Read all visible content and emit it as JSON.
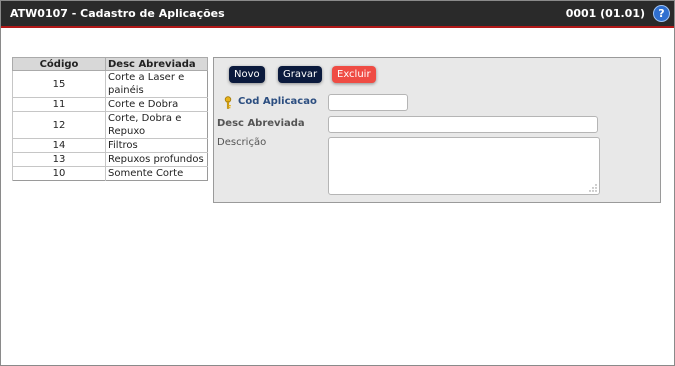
{
  "window": {
    "title": "ATW0107 - Cadastro de Aplicações",
    "code": "0001 (01.01)",
    "help_label": "?"
  },
  "list": {
    "headers": {
      "code": "Código",
      "desc": "Desc Abreviada"
    },
    "rows": [
      {
        "code": "15",
        "desc": "Corte a Laser e painéis"
      },
      {
        "code": "11",
        "desc": "Corte e Dobra"
      },
      {
        "code": "12",
        "desc": "Corte, Dobra e Repuxo"
      },
      {
        "code": "14",
        "desc": "Filtros"
      },
      {
        "code": "13",
        "desc": "Repuxos profundos"
      },
      {
        "code": "10",
        "desc": "Somente Corte"
      }
    ]
  },
  "toolbar": {
    "new_label": "Novo",
    "save_label": "Gravar",
    "delete_label": "Excluir"
  },
  "form": {
    "cod_label": "Cod Aplicacao",
    "cod_value": "",
    "desc_abrev_label": "Desc Abreviada",
    "desc_abrev_value": "",
    "descricao_label": "Descrição",
    "descricao_value": ""
  },
  "colors": {
    "titlebar": "#2a2a2a",
    "titlebar_border": "#b01818",
    "button_dark": "#0b1a3d",
    "button_delete": "#ef4c44",
    "key_label": "#2c4e80"
  },
  "icons": {
    "help": "help-icon",
    "key": "key-icon",
    "resize": "resize-grip-icon"
  }
}
